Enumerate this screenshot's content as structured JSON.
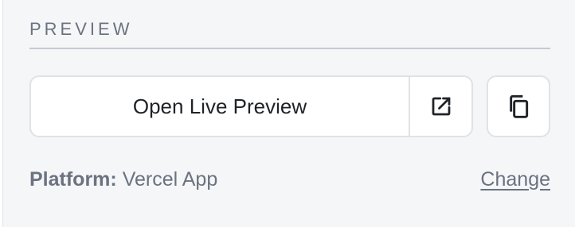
{
  "section": {
    "title": "PREVIEW"
  },
  "preview": {
    "open_label": "Open Live Preview",
    "open_external_icon": "external-link-icon",
    "copy_icon": "copy-icon"
  },
  "platform": {
    "label": "Platform:",
    "value": "Vercel App",
    "change_label": "Change"
  }
}
